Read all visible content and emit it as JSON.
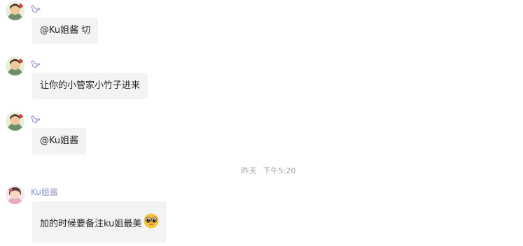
{
  "messages": [
    {
      "sender_name": "",
      "sender_icon": "hand-pointing-icon",
      "avatar": "cartoon-avatar",
      "text": "@Ku姐酱 切"
    },
    {
      "sender_name": "",
      "sender_icon": "hand-pointing-icon",
      "avatar": "cartoon-avatar",
      "text": "让你的小管家小竹子进来"
    },
    {
      "sender_name": "",
      "sender_icon": "hand-pointing-icon",
      "avatar": "cartoon-avatar",
      "text": "@Ku姐酱"
    }
  ],
  "divider": {
    "day": "昨天",
    "time": "下午5:20"
  },
  "last_message": {
    "sender_name": "Ku姐酱",
    "avatar": "girl-avatar",
    "text": "加的时候要备注ku姐最美",
    "emoji": "pleading-face-emoji"
  },
  "colors": {
    "bubble": "#f3f3f3",
    "sender_name": "#8a93bd",
    "timestamp": "#a3a3a3"
  }
}
